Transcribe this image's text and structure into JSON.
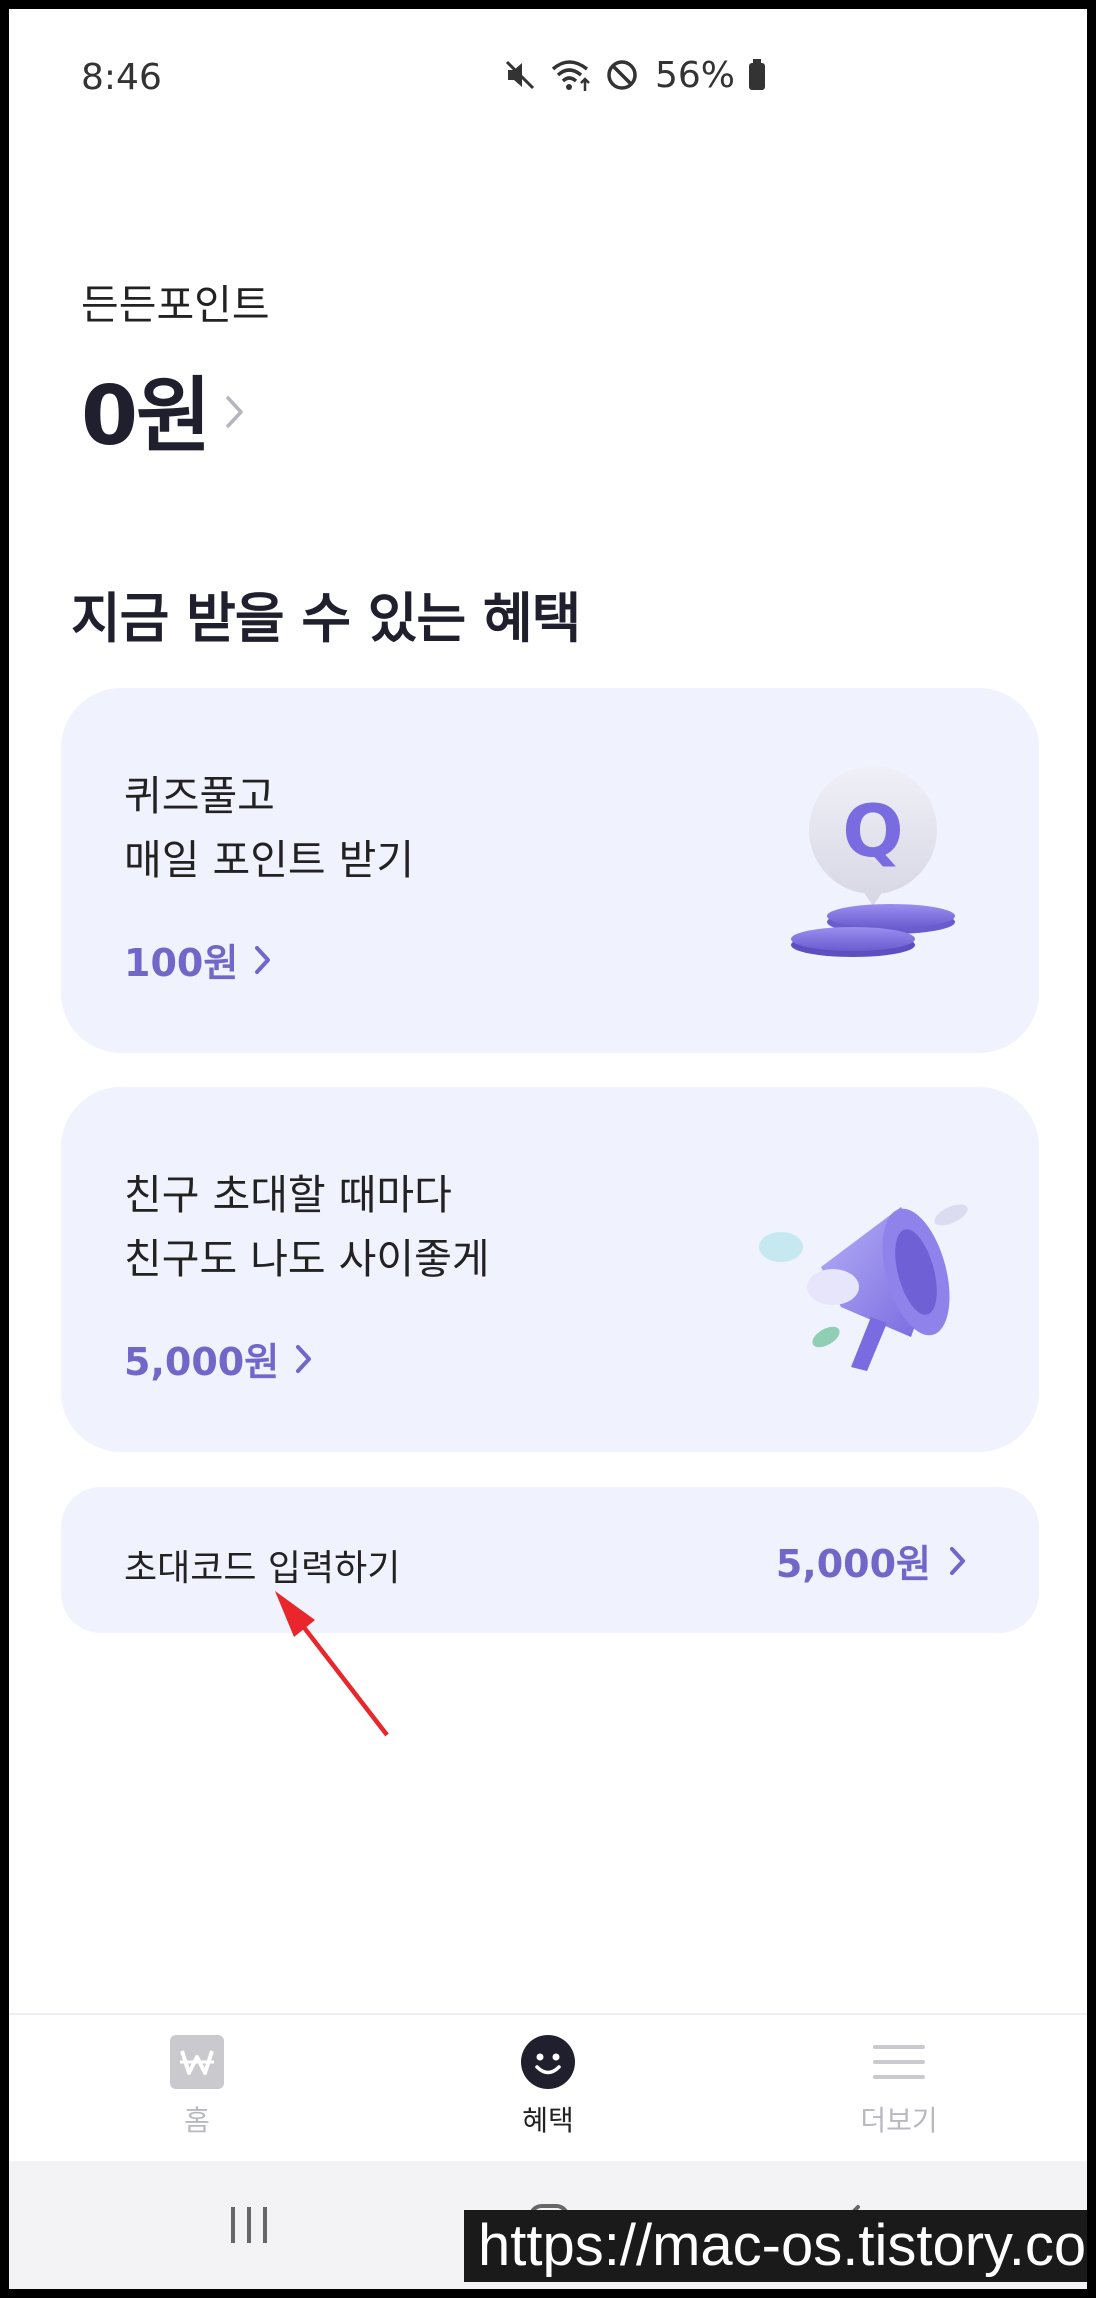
{
  "status_bar": {
    "time": "8:46",
    "battery": "56%"
  },
  "points": {
    "label": "든든포인트",
    "amount": "0원"
  },
  "section_title": "지금 받을 수 있는 혜택",
  "cards": [
    {
      "line1": "퀴즈풀고",
      "line2": "매일 포인트 받기",
      "reward": "100원",
      "illustration": "quiz-speech-bubble-coins-icon"
    },
    {
      "line1": "친구 초대할 때마다",
      "line2": "친구도 나도 사이좋게",
      "reward": "5,000원",
      "illustration": "megaphone-icon"
    }
  ],
  "invite_code": {
    "label": "초대코드 입력하기",
    "reward": "5,000원"
  },
  "bottom_nav": [
    {
      "label": "홈",
      "icon": "won-icon",
      "active": false
    },
    {
      "label": "혜택",
      "icon": "smile-icon",
      "active": true
    },
    {
      "label": "더보기",
      "icon": "menu-icon",
      "active": false
    }
  ],
  "colors": {
    "accent": "#7266c8",
    "card_bg": "#f0f2fd",
    "title": "#1f1f2e",
    "annotation_arrow": "#e8262b"
  },
  "watermark": "https://mac-os.tistory.com"
}
